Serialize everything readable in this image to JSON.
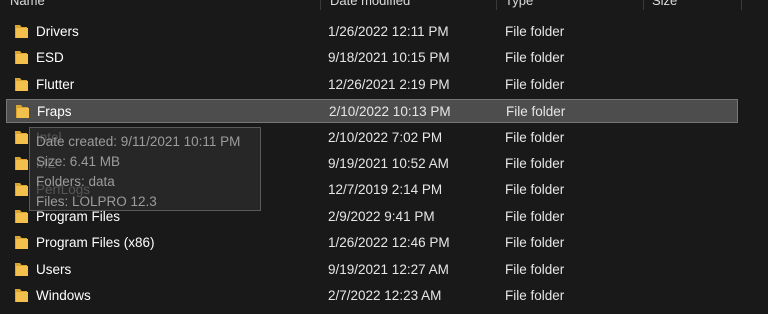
{
  "header": {
    "columns": [
      "Name",
      "Date modified",
      "Type",
      "Size"
    ]
  },
  "colors": {
    "background": "#191919",
    "selected_row": "#4d4d4d",
    "folder": "#f3c04d"
  },
  "files": [
    {
      "name": "Drivers",
      "date": "1/26/2022 12:11 PM",
      "type": "File folder",
      "icon": "folder-icon"
    },
    {
      "name": "ESD",
      "date": "9/18/2021 10:15 PM",
      "type": "File folder",
      "icon": "folder-icon"
    },
    {
      "name": "Flutter",
      "date": "12/26/2021 2:19 PM",
      "type": "File folder",
      "icon": "folder-icon"
    },
    {
      "name": "Fraps",
      "date": "2/10/2022 10:13 PM",
      "type": "File folder",
      "icon": "folder-icon",
      "selected": true
    },
    {
      "name": "Intel",
      "date": "2/10/2022 7:02 PM",
      "type": "File folder",
      "icon": "folder-icon"
    },
    {
      "name": "ME",
      "date": "9/19/2021 10:52 AM",
      "type": "File folder",
      "icon": "folder-icon"
    },
    {
      "name": "PerfLogs",
      "date": "12/7/2019 2:14 PM",
      "type": "File folder",
      "icon": "folder-icon"
    },
    {
      "name": "Program Files",
      "date": "2/9/2022 9:41 PM",
      "type": "File folder",
      "icon": "folder-icon"
    },
    {
      "name": "Program Files (x86)",
      "date": "1/26/2022 12:46 PM",
      "type": "File folder",
      "icon": "folder-icon"
    },
    {
      "name": "Users",
      "date": "9/19/2021 12:27 AM",
      "type": "File folder",
      "icon": "folder-icon"
    },
    {
      "name": "Windows",
      "date": "2/7/2022 12:23 AM",
      "type": "File folder",
      "icon": "folder-icon"
    }
  ],
  "tooltip": {
    "lines": [
      "Date created: 9/11/2021 10:11 PM",
      "Size: 6.41 MB",
      "Folders: data",
      "Files: LOLPRO 12.3"
    ]
  }
}
